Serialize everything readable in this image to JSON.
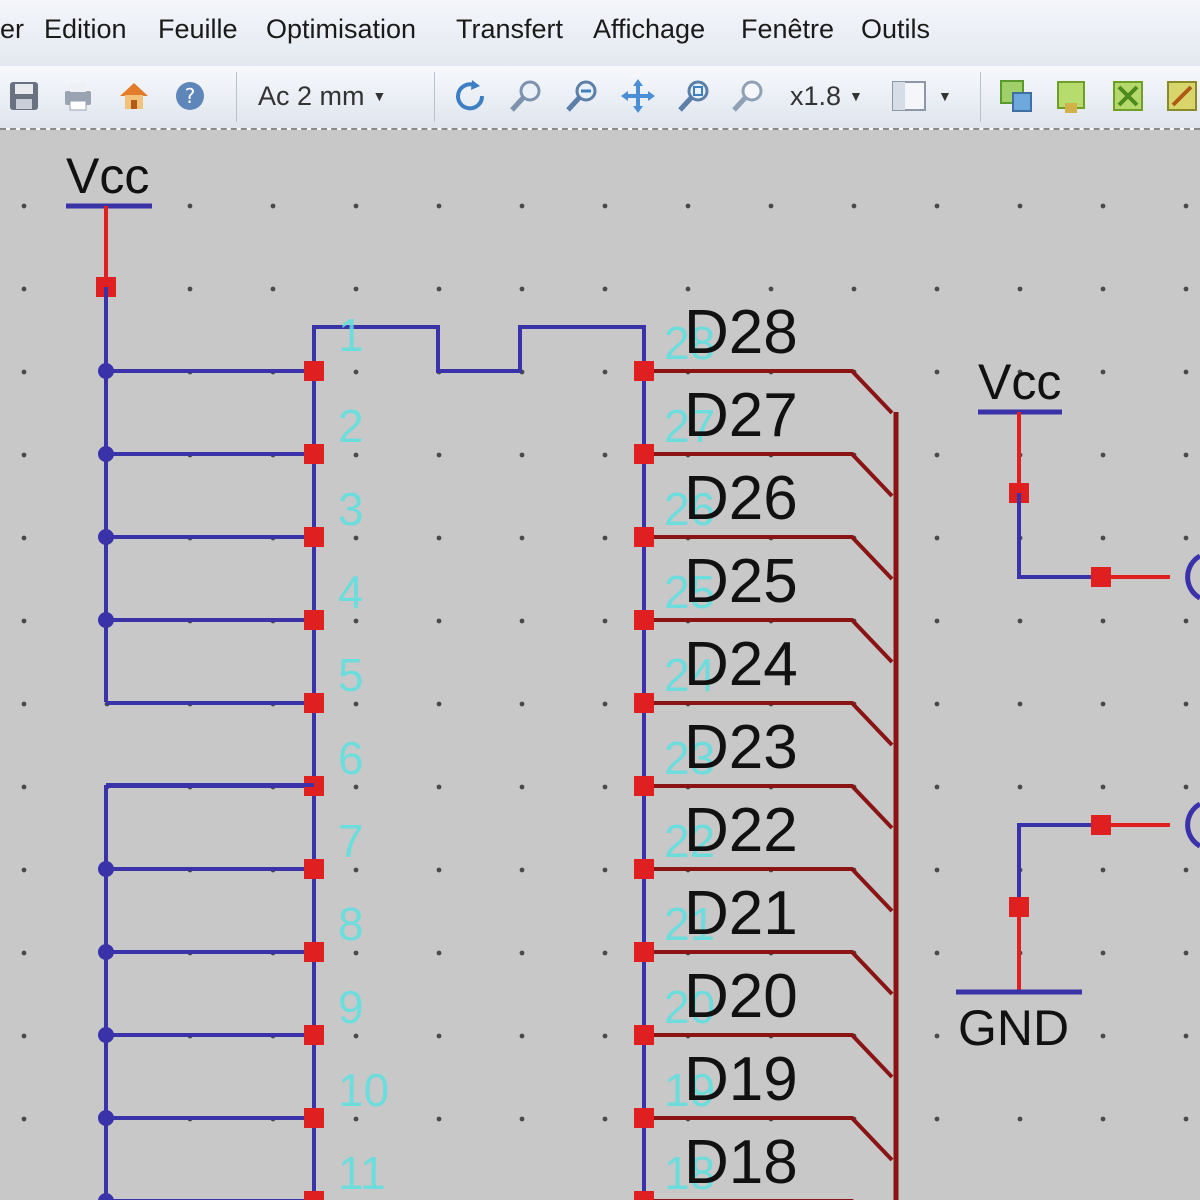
{
  "menu": {
    "items": [
      "er",
      "Edition",
      "Feuille",
      "Optimisation",
      "Transfert",
      "Affichage",
      "Fenêtre",
      "Outils"
    ]
  },
  "toolbar": {
    "buttons_left": [
      "save-icon",
      "print-icon",
      "home-icon",
      "help-icon"
    ],
    "grid_combo": "Ac 2 mm",
    "zoom_buttons": [
      "rotate-icon",
      "zoom-in-icon",
      "zoom-out-icon",
      "pan-icon",
      "zoom-window-icon",
      "zoom-fit-icon"
    ],
    "zoom_combo": "x1.8",
    "view_combo_icon": "page-icon",
    "buttons_right": [
      "component-add-icon",
      "component-place-icon",
      "component-delete-icon",
      "component-move-icon"
    ]
  },
  "colors": {
    "background": "#c8c8c8",
    "wire_blue": "#3a32a8",
    "wire_red": "#e02020",
    "bus_dark_red": "#8a1414",
    "pin_number": "#5ee0e0",
    "grid_dot": "#4a4a4a"
  },
  "schematic": {
    "vcc_left": "Vcc",
    "vcc_right": "Vcc",
    "gnd_right": "GND",
    "left_pin_numbers": [
      "1",
      "2",
      "3",
      "4",
      "5",
      "6",
      "7",
      "8",
      "9",
      "10",
      "11"
    ],
    "right_pin_numbers": [
      "28",
      "27",
      "26",
      "25",
      "24",
      "23",
      "22",
      "21",
      "20",
      "19",
      "18"
    ],
    "right_signals": [
      "D28",
      "D27",
      "D26",
      "D25",
      "D24",
      "D23",
      "D22",
      "D21",
      "D20",
      "D19",
      "D18"
    ]
  }
}
